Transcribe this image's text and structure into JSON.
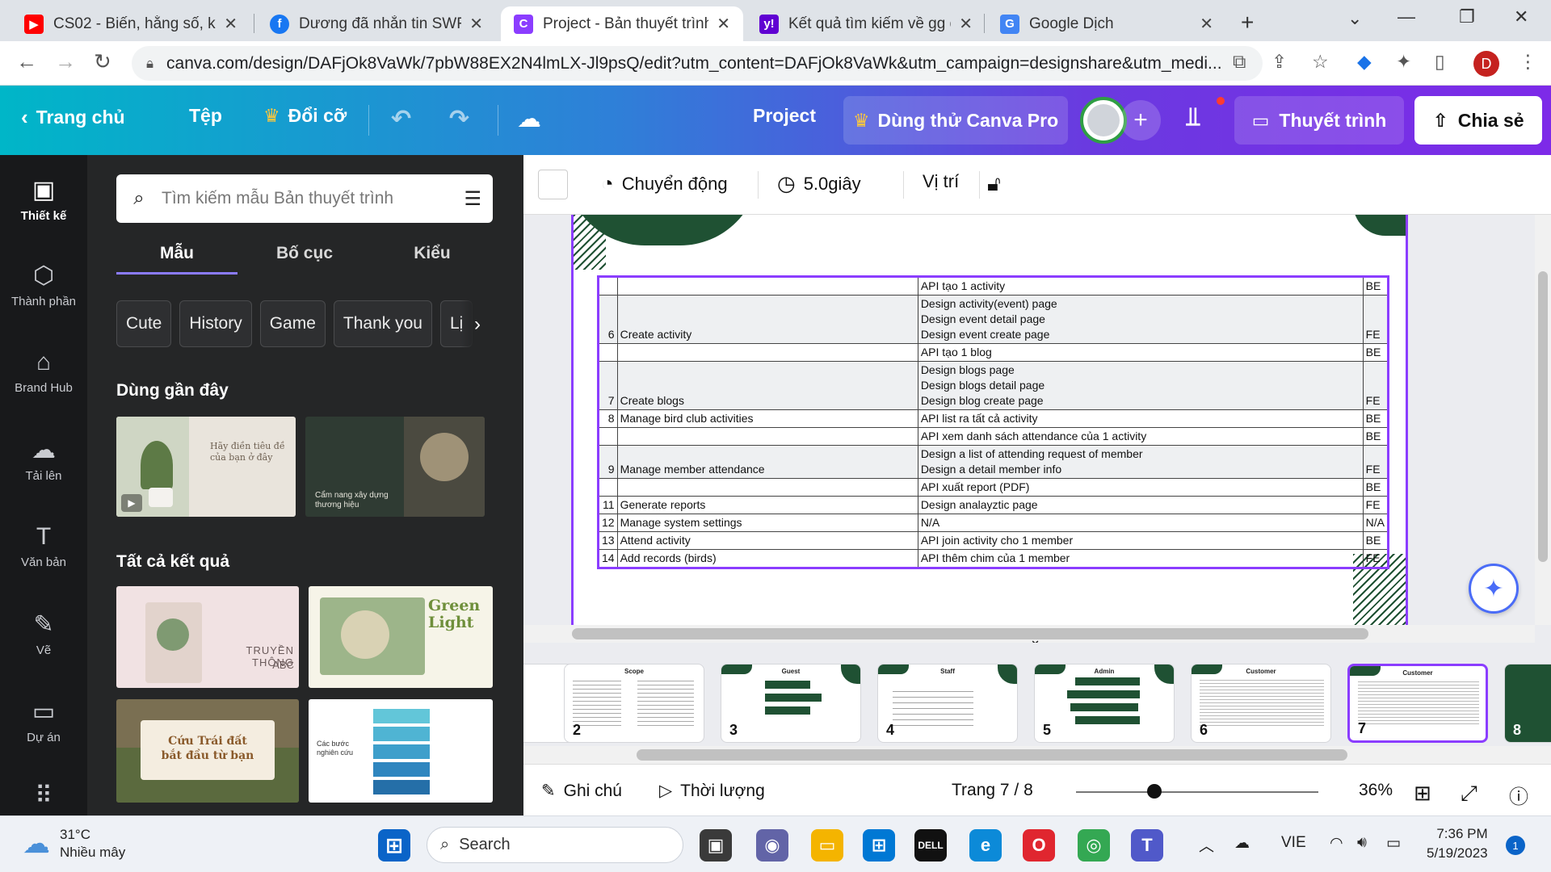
{
  "browser": {
    "tabs": [
      {
        "title": "CS02 - Biến, hằng số, kiểu",
        "favicon": "youtube-icon",
        "color": "#ff0000"
      },
      {
        "title": "Dương đã nhắn tin SWR1(",
        "favicon": "facebook-icon",
        "color": "#1877f2"
      },
      {
        "title": "Project - Bản thuyết trình",
        "favicon": "canva-icon",
        "color": "#8b3dff"
      },
      {
        "title": "Kết quả tìm kiếm về gg d",
        "favicon": "yahoo-icon",
        "color": "#6001d2"
      },
      {
        "title": "Google Dịch",
        "favicon": "google-translate-icon",
        "color": "#4285f4"
      }
    ],
    "url": "canva.com/design/DAFjOk8VaWk/7pbW88EX2N4lmLX-Jl9psQ/edit?utm_content=DAFjOk8VaWk&utm_campaign=designshare&utm_medi...",
    "profile_initial": "D"
  },
  "canva_header": {
    "home": "Trang chủ",
    "file": "Tệp",
    "resize": "Đổi cỡ",
    "project_name": "Project",
    "pro_trial": "Dùng thử Canva Pro",
    "present": "Thuyết trình",
    "share": "Chia sẻ"
  },
  "rail": [
    {
      "label": "Thiết kế",
      "icon": "layout-icon",
      "glyph": "▣"
    },
    {
      "label": "Thành phần",
      "icon": "elements-icon",
      "glyph": "⬡"
    },
    {
      "label": "Brand Hub",
      "icon": "brand-hub-icon",
      "glyph": "⌂"
    },
    {
      "label": "Tải lên",
      "icon": "upload-icon",
      "glyph": "☁"
    },
    {
      "label": "Văn bản",
      "icon": "text-icon",
      "glyph": "T"
    },
    {
      "label": "Vẽ",
      "icon": "draw-icon",
      "glyph": "✎"
    },
    {
      "label": "Dự án",
      "icon": "folder-icon",
      "glyph": "▭"
    }
  ],
  "panel": {
    "search_placeholder": "Tìm kiếm mẫu Bản thuyết trình",
    "tabs": [
      "Mẫu",
      "Bố cục",
      "Kiểu"
    ],
    "chips": [
      "Cute",
      "History",
      "Game",
      "Thank you",
      "Lị"
    ],
    "recent_title": "Dùng gần đây",
    "recent": [
      {
        "text": "Hãy điền tiêu đề của bạn ở đây",
        "bg": "#e9e4dc"
      },
      {
        "text": "Cẩm nang xây dựng thương hiệu",
        "bg": "#2f3b33"
      }
    ],
    "all_title": "Tất cả kết quả",
    "results": [
      {
        "line1": "TRUYỀN THÔNG",
        "line2": "ABC",
        "bg": "#f1e2e3"
      },
      {
        "line1": "Green",
        "line2": "Light",
        "bg": "#f6f4e8"
      },
      {
        "line1": "Cứu Trái đất",
        "line2": "bắt đầu từ bạn",
        "bg": "#7a6f52"
      },
      {
        "line1": "Các bước nghiên cứu",
        "line2": "",
        "bg": "#ffffff"
      }
    ]
  },
  "editor_toolbar": {
    "animate": "Chuyển động",
    "duration": "5.0giây",
    "position": "Vị trí"
  },
  "slide_table": [
    {
      "no": "",
      "task": "",
      "sub": "API tạo 1 activity",
      "type": "BE"
    },
    {
      "no": "6",
      "task": "Create activity",
      "sub": "Design activity(event) page\n Design event detail page\n Design event create page",
      "type": "FE"
    },
    {
      "no": "",
      "task": "",
      "sub": "API tạo 1 blog",
      "type": "BE"
    },
    {
      "no": "7",
      "task": "Create blogs",
      "sub": "Design blogs page\n Design blogs detail page\n Design blog create page",
      "type": "FE"
    },
    {
      "no": "8",
      "task": "Manage bird club activities",
      "sub": "API list ra tất cả activity",
      "type": "BE"
    },
    {
      "no": "",
      "task": "",
      "sub": "API xem danh sách attendance của 1 activity",
      "type": "BE"
    },
    {
      "no": "9",
      "task": "Manage member attendance",
      "sub": "Design a list of attending request of member\n Design a detail member info",
      "type": "FE"
    },
    {
      "no": "",
      "task": "",
      "sub": "API xuất report (PDF)",
      "type": "BE"
    },
    {
      "no": "11",
      "task": "Generate reports",
      "sub": "Design analayztic page",
      "type": "FE"
    },
    {
      "no": "12",
      "task": "Manage system settings",
      "sub": "N/A",
      "type": "N/A"
    },
    {
      "no": "13",
      "task": "Attend activity",
      "sub": "API join activity cho 1 member",
      "type": "BE"
    },
    {
      "no": "14",
      "task": "Add records (birds)",
      "sub": "API thêm chim của 1 member",
      "type": "FE"
    }
  ],
  "pages": [
    {
      "num": "2",
      "title": "Scope"
    },
    {
      "num": "3",
      "title": "Guest"
    },
    {
      "num": "4",
      "title": "Staff"
    },
    {
      "num": "5",
      "title": "Admin"
    },
    {
      "num": "6",
      "title": "Customer"
    },
    {
      "num": "7",
      "title": "Customer"
    },
    {
      "num": "8",
      "title": ""
    }
  ],
  "footer": {
    "notes": "Ghi chú",
    "duration": "Thời lượng",
    "page_indicator": "Trang 7 / 8",
    "zoom": "36%"
  },
  "taskbar": {
    "temperature": "31°C",
    "weather": "Nhiều mây",
    "search": "Search",
    "language": "VIE",
    "time": "7:36 PM",
    "date": "5/19/2023",
    "notifications": "1"
  }
}
